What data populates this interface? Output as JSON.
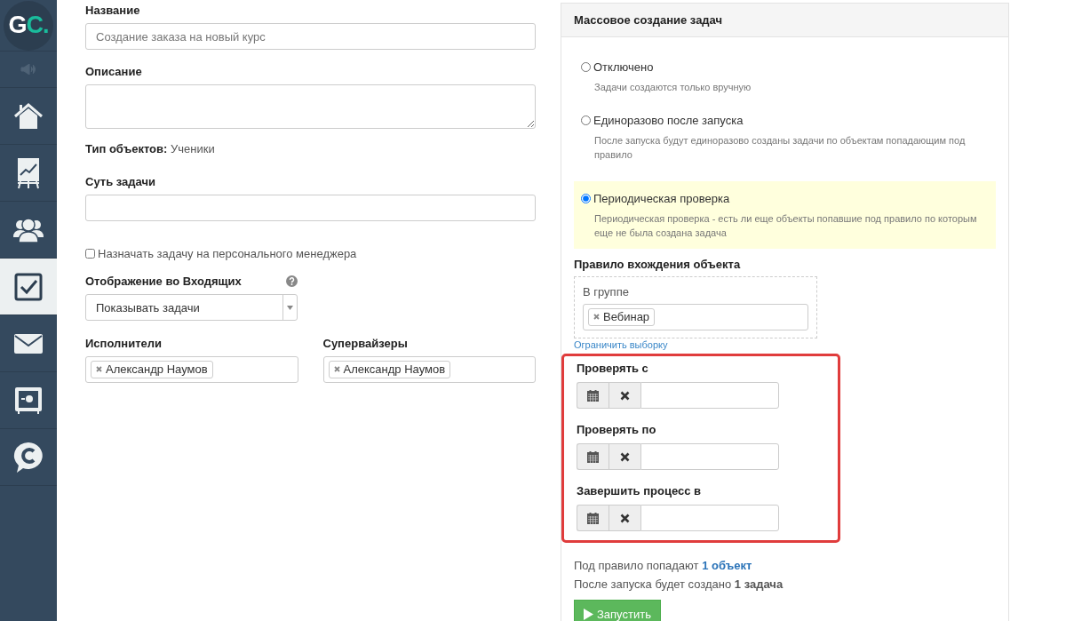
{
  "sidebar": {
    "logo": [
      "G",
      "C."
    ],
    "items": [
      {
        "kind": "speaker",
        "selected": false
      },
      {
        "kind": "home",
        "selected": false
      },
      {
        "kind": "chart",
        "selected": false
      },
      {
        "kind": "people",
        "selected": false
      },
      {
        "kind": "tasks",
        "selected": true
      },
      {
        "kind": "mail",
        "selected": false
      },
      {
        "kind": "safe",
        "selected": false
      },
      {
        "kind": "chat",
        "selected": false
      }
    ]
  },
  "form": {
    "name": {
      "label": "Название",
      "placeholder": "Создание заказа на новый курс"
    },
    "description": {
      "label": "Описание"
    },
    "object_type": {
      "label": "Тип объектов:",
      "value": "Ученики"
    },
    "essence": {
      "label": "Суть задачи"
    },
    "assign_manager": {
      "label": "Назначать задачу на персонального менеджера",
      "checked": false
    },
    "inbox_display": {
      "label": "Отображение во Входящих",
      "value": "Показывать задачи"
    },
    "executors": {
      "label": "Исполнители",
      "tags": [
        "Александр Наумов"
      ]
    },
    "supervisors": {
      "label": "Супервайзеры",
      "tags": [
        "Александр Наумов"
      ]
    }
  },
  "mass_panel": {
    "title": "Массовое создание задач",
    "options": [
      {
        "label": "Отключено",
        "hint": "Задачи создаются только вручную",
        "selected": false
      },
      {
        "label": "Единоразово после запуска",
        "hint": "После запуска будут единоразово созданы задачи по объектам попадающим под правило",
        "selected": false
      },
      {
        "label": "Периодическая проверка",
        "hint": "Периодическая проверка - есть ли еще объекты попавшие под правило по которым еще не была создана задача",
        "selected": true
      }
    ],
    "rule": {
      "label": "Правило вхождения объекта",
      "condition": "В группе",
      "tags": [
        "Вебинар"
      ],
      "link": "Ограничить выборку"
    },
    "dates_highlighted": true,
    "dates": [
      {
        "label": "Проверять с"
      },
      {
        "label": "Проверять по"
      },
      {
        "label": "Завершить процесс в"
      }
    ],
    "match_text": "Под правило попадают",
    "match_link": "1 объект",
    "result_text": "После запуска будет создано **1 задача**",
    "run_button": "Запустить"
  }
}
